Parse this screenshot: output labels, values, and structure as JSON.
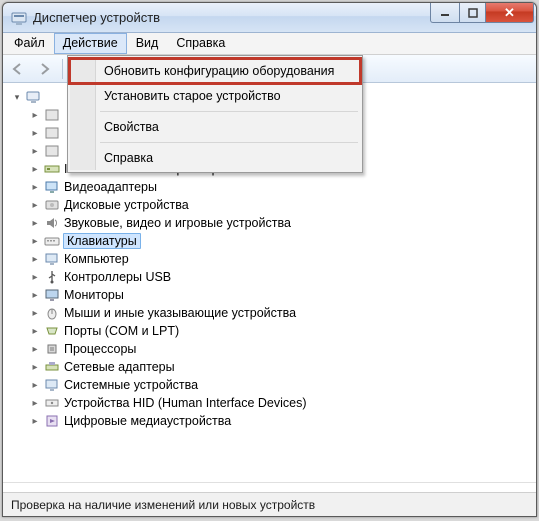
{
  "window": {
    "title": "Диспетчер устройств"
  },
  "menubar": {
    "file": "Файл",
    "action": "Действие",
    "view": "Вид",
    "help": "Справка"
  },
  "dropdown": {
    "scan": "Обновить конфигурацию оборудования",
    "legacy": "Установить старое устройство",
    "properties": "Свойства",
    "help": "Справка"
  },
  "tree": {
    "hidden0": "",
    "hidden1": "",
    "hidden2": "",
    "ide": "IDE ATA/ATAPI контроллеры",
    "video": "Видеоадаптеры",
    "disk": "Дисковые устройства",
    "sound": "Звуковые, видео и игровые устройства",
    "keyboard": "Клавиатуры",
    "computer": "Компьютер",
    "usb": "Контроллеры USB",
    "monitor": "Мониторы",
    "mouse": "Мыши и иные указывающие устройства",
    "ports": "Порты (COM и LPT)",
    "cpu": "Процессоры",
    "network": "Сетевые адаптеры",
    "system": "Системные устройства",
    "hid": "Устройства HID (Human Interface Devices)",
    "media": "Цифровые медиаустройства"
  },
  "statusbar": {
    "text": "Проверка на наличие изменений или новых устройств"
  }
}
